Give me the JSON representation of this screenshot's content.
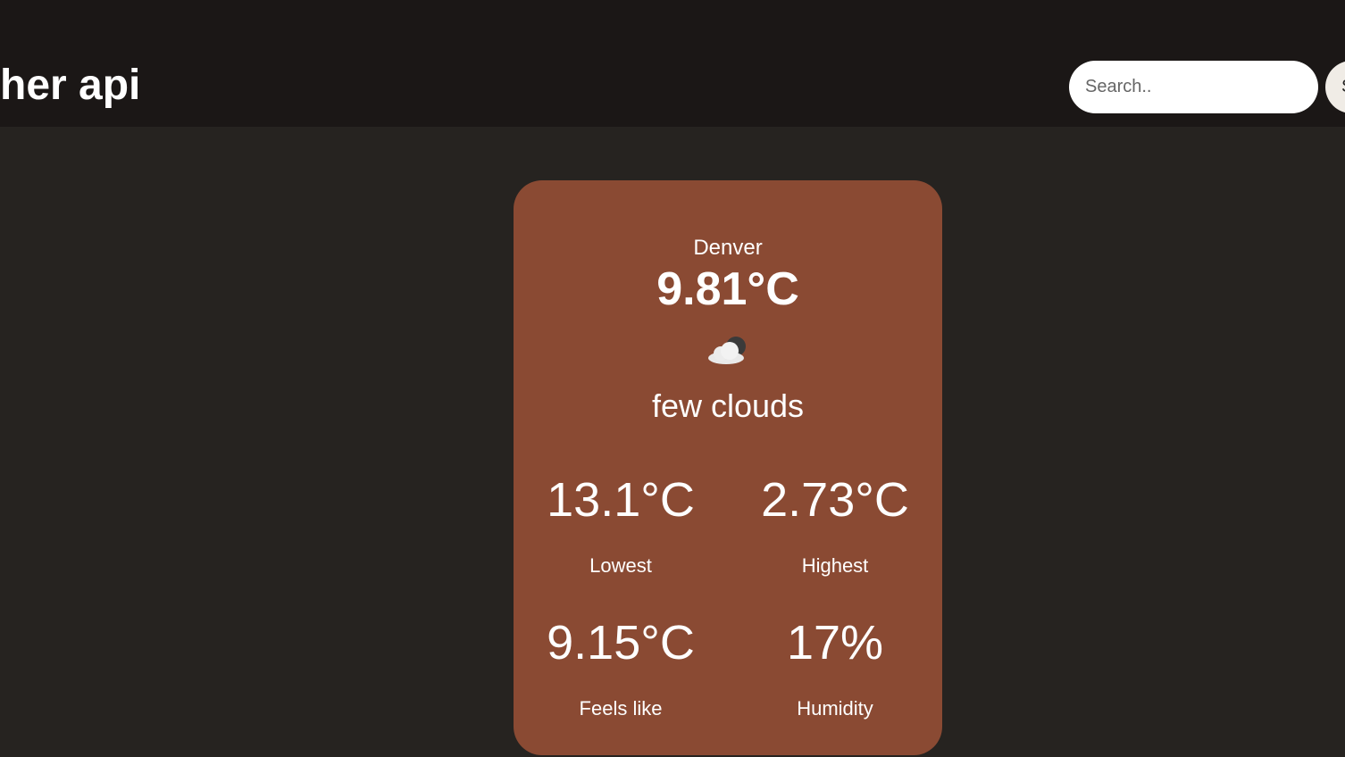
{
  "header": {
    "title": "her api",
    "search_placeholder": "Search..",
    "search_button_label": "S"
  },
  "weather": {
    "city": "Denver",
    "temperature": "9.81°C",
    "icon": "few-clouds-night-icon",
    "description": "few clouds",
    "stats": [
      {
        "value": "13.1°C",
        "label": "Lowest"
      },
      {
        "value": "2.73°C",
        "label": "Highest"
      },
      {
        "value": "9.15°C",
        "label": "Feels like"
      },
      {
        "value": "17%",
        "label": "Humidity"
      }
    ]
  },
  "colors": {
    "background": "#262320",
    "header_background": "#1b1716",
    "card_background": "#8a4a33",
    "text": "#ffffff"
  }
}
